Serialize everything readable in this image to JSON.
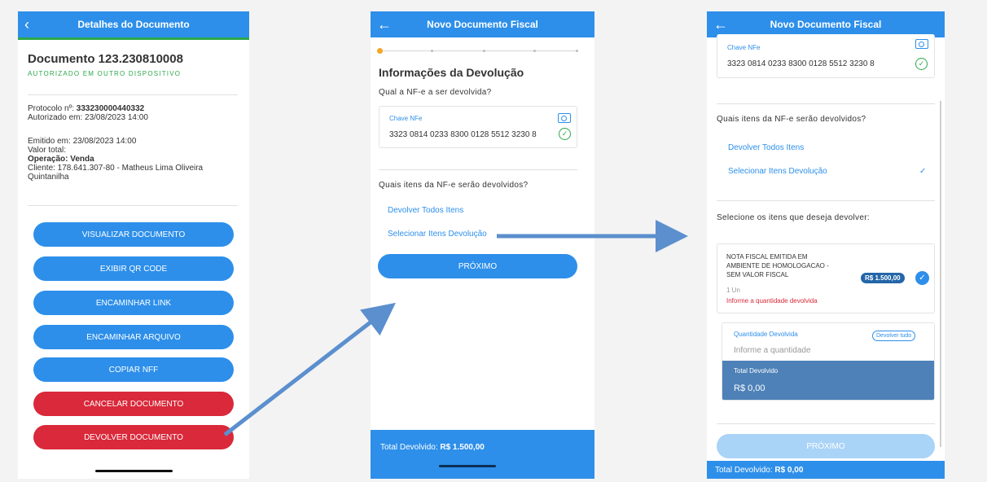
{
  "screen1": {
    "title": "Detalhes do Documento",
    "back_icon": "back-chevron-icon",
    "doc_title": "Documento 123.230810008",
    "status": "AUTORIZADO EM OUTRO DISPOSITIVO",
    "protocolo_label": "Protocolo nº: ",
    "protocolo_value": "333230000440332",
    "autorizado": "Autorizado em: 23/08/2023 14:00",
    "emitido": "Emitido em: 23/08/2023 14:00",
    "valor_total": "Valor total:",
    "operacao": "Operação: Venda",
    "cliente_line1": "Cliente: 178.641.307-80 - Matheus Lima Oliveira",
    "cliente_line2": "Quintanilha",
    "buttons": [
      "VISUALIZAR DOCUMENTO",
      "EXIBIR QR CODE",
      "ENCAMINHAR LINK",
      "ENCAMINHAR ARQUIVO",
      "COPIAR NFF",
      "CANCELAR DOCUMENTO",
      "DEVOLVER DOCUMENTO"
    ]
  },
  "screen2": {
    "title": "Novo Documento Fiscal",
    "back_icon": "back-arrow-icon",
    "heading": "Informações da Devolução",
    "question": "Qual a NF-e a ser devolvida?",
    "chave_label": "Chave NFe",
    "chave_value": "3323 0814 0233 8300 0128 5512 3230 8",
    "items_question": "Quais itens da NF-e serão devolvidos?",
    "opt_all": "Devolver Todos Itens",
    "opt_select": "Selecionar Itens Devolução",
    "next_label": "PRÓXIMO",
    "footer_label": "Total Devolvido: ",
    "footer_value": "R$ 1.500,00"
  },
  "screen3": {
    "title": "Novo Documento Fiscal",
    "back_icon": "back-arrow-icon",
    "chave_label": "Chave NFe",
    "chave_value": "3323 0814 0233 8300 0128 5512 3230 8",
    "items_question": "Quais itens da NF-e serão devolvidos?",
    "opt_all": "Devolver Todos Itens",
    "opt_select": "Selecionar Itens Devolução",
    "select_prompt": "Selecione os itens que deseja devolver:",
    "item_desc": "NOTA FISCAL EMITIDA EM AMBIENTE DE HOMOLOGACAO - SEM VALOR FISCAL",
    "item_qty": "1 Un",
    "item_price": "R$ 1.500,00",
    "item_warning": "Informe a quantidade devolvida",
    "qty_label": "Quantidade Devolvida",
    "qty_all_button": "Devolver tudo",
    "qty_placeholder": "Informe a quantidade",
    "total_label": "Total Devolvido",
    "total_value": "R$ 0,00",
    "next_label": "PRÓXIMO",
    "footer_label": "Total Devolvido: ",
    "footer_value": "R$ 0,00"
  },
  "colors": {
    "primary_blue": "#2d8fea",
    "danger_red": "#d9293a",
    "success_green": "#2ca84a",
    "accent_orange": "#f5a623"
  }
}
